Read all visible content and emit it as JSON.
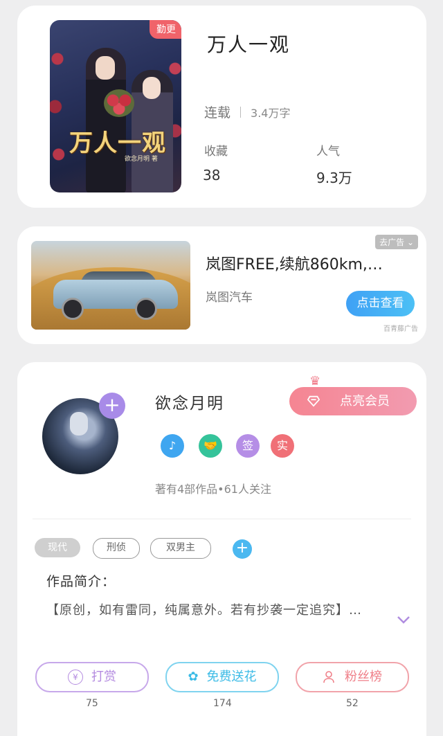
{
  "book": {
    "cover_title": "万人一观",
    "cover_author": "欲念月明 著",
    "badge": "勤更",
    "title": "万人一观",
    "status": "连载",
    "word_count": "3.4万字",
    "favorites_label": "收藏",
    "favorites_value": "38",
    "popularity_label": "人气",
    "popularity_value": "9.3万"
  },
  "ad": {
    "title": "岚图FREE,续航860km,…",
    "brand": "岚图汽车",
    "close_label": "去广告",
    "cta_label": "点击查看",
    "source": "百青藤广告"
  },
  "author": {
    "name": "欲念月明",
    "member_button": "点亮会员",
    "honor_badges": [
      {
        "icon": "music-note-icon",
        "text": "♪",
        "color": "#3fa6f0"
      },
      {
        "icon": "handshake-icon",
        "text": "🤝",
        "color": "#35c39a"
      },
      {
        "icon": "sign-badge",
        "text": "签",
        "color": "#b58ee6"
      },
      {
        "icon": "real-name-badge",
        "text": "实",
        "color": "#f07077"
      }
    ],
    "works_line": "著有4部作品•61人关注"
  },
  "tags": [
    {
      "label": "现代",
      "active": true
    },
    {
      "label": "刑侦",
      "active": false
    },
    {
      "label": "双男主",
      "active": false
    }
  ],
  "intro": {
    "label": "作品简介：",
    "text": "【原创，如有雷同，纯属意外。若有抄袭一定追究】…"
  },
  "actions": [
    {
      "label": "打赏",
      "count": "75",
      "icon": "yen-coin-icon",
      "color": "#b48be0"
    },
    {
      "label": "免费送花",
      "count": "174",
      "icon": "flower-icon",
      "color": "#3cbbe6"
    },
    {
      "label": "粉丝榜",
      "count": "52",
      "icon": "user-icon",
      "color": "#ef7f88"
    }
  ]
}
